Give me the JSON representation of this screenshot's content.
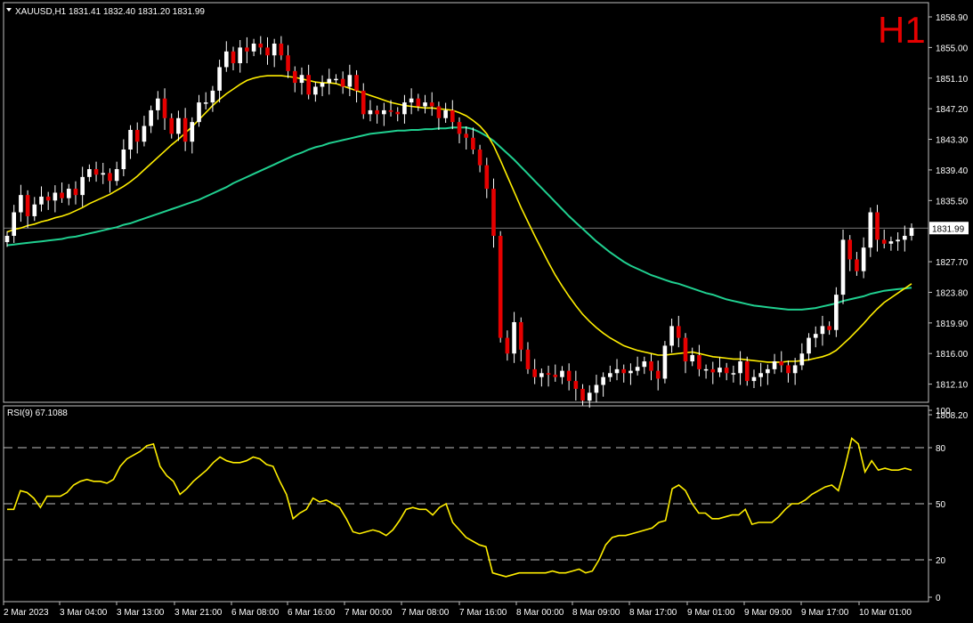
{
  "header": {
    "symbol_line": "XAUUSD,H1  1831.41 1832.40 1831.20 1831.99",
    "timeframe_badge": "H1",
    "rsi_label": "RSI(9) 67.1088"
  },
  "colors": {
    "background": "#000000",
    "bull_candle": "#ffffff",
    "bear_candle": "#e60000",
    "wick": "#ffffff",
    "ma_fast": "#ffee00",
    "ma_slow": "#20d090",
    "rsi_line": "#ffee00",
    "grid_frame": "#c0c0c0",
    "badge": "#e60000"
  },
  "chart_data": [
    {
      "type": "candlestick",
      "title": "XAUUSD,H1",
      "ylim": [
        1808.2,
        1858.9
      ],
      "yticks": [
        1858.9,
        1855.0,
        1851.1,
        1847.2,
        1843.3,
        1839.4,
        1835.5,
        1831.99,
        1827.7,
        1823.8,
        1819.9,
        1816.0,
        1812.1,
        1808.2
      ],
      "ytick_labels": [
        "1858.90",
        "1855.00",
        "1851.10",
        "1847.20",
        "1843.30",
        "1839.40",
        "1835.50",
        "1831.99",
        "1827.70",
        "1823.80",
        "1819.90",
        "1816.00",
        "1812.10",
        "1808.20"
      ],
      "current_price": 1831.99,
      "xtick_labels": [
        "2 Mar 2023",
        "3 Mar 04:00",
        "3 Mar 13:00",
        "3 Mar 21:00",
        "6 Mar 08:00",
        "6 Mar 16:00",
        "7 Mar 00:00",
        "7 Mar 08:00",
        "7 Mar 16:00",
        "8 Mar 00:00",
        "8 Mar 09:00",
        "8 Mar 17:00",
        "9 Mar 01:00",
        "9 Mar 09:00",
        "9 Mar 17:00",
        "10 Mar 01:00"
      ],
      "close": [
        1831.0,
        1834.0,
        1836.2,
        1833.5,
        1835.0,
        1836.0,
        1835.5,
        1836.5,
        1835.8,
        1837.0,
        1836.2,
        1838.5,
        1839.5,
        1838.8,
        1839.0,
        1838.0,
        1839.5,
        1842.0,
        1844.5,
        1843.0,
        1845.0,
        1847.0,
        1848.5,
        1846.0,
        1844.0,
        1846.0,
        1843.0,
        1845.5,
        1848.0,
        1848.0,
        1849.5,
        1852.5,
        1854.5,
        1853.0,
        1855.0,
        1854.5,
        1855.5,
        1855.0,
        1854.0,
        1855.5,
        1854.0,
        1852.0,
        1850.5,
        1851.5,
        1849.0,
        1850.0,
        1850.5,
        1851.0,
        1851.0,
        1850.0,
        1851.5,
        1849.5,
        1846.5,
        1847.0,
        1846.5,
        1847.0,
        1846.8,
        1846.5,
        1848.0,
        1848.5,
        1847.5,
        1848.0,
        1847.5,
        1846.0,
        1847.0,
        1845.5,
        1844.0,
        1843.5,
        1842.0,
        1840.0,
        1837.0,
        1831.0,
        1818.0,
        1816.0,
        1820.0,
        1816.5,
        1814.0,
        1813.0,
        1813.5,
        1813.3,
        1813.0,
        1813.8,
        1812.5,
        1811.5,
        1810.0,
        1811.0,
        1812.0,
        1813.0,
        1813.5,
        1814.0,
        1813.5,
        1813.8,
        1814.3,
        1815.0,
        1813.8,
        1812.8,
        1817.0,
        1819.5,
        1818.0,
        1815.0,
        1815.8,
        1814.0,
        1814.0,
        1813.6,
        1814.2,
        1813.5,
        1813.5,
        1815.0,
        1812.5,
        1813.0,
        1813.5,
        1814.0,
        1815.0,
        1814.5,
        1813.5,
        1814.5,
        1816.0,
        1818.0,
        1818.5,
        1819.5,
        1819.0,
        1823.5,
        1830.5,
        1828.0,
        1826.5,
        1829.5,
        1834.0,
        1830.5,
        1830.0,
        1830.3,
        1830.5,
        1831.0,
        1831.99
      ],
      "ma_fast": [
        1831.5,
        1831.8,
        1832.0,
        1832.3,
        1832.5,
        1832.8,
        1833.0,
        1833.3,
        1833.5,
        1833.8,
        1834.2,
        1834.6,
        1835.1,
        1835.5,
        1835.9,
        1836.3,
        1836.8,
        1837.3,
        1837.9,
        1838.6,
        1839.4,
        1840.2,
        1841.0,
        1841.8,
        1842.6,
        1843.3,
        1844.1,
        1844.9,
        1845.8,
        1846.7,
        1847.6,
        1848.4,
        1849.1,
        1849.7,
        1850.3,
        1850.8,
        1851.1,
        1851.3,
        1851.4,
        1851.4,
        1851.4,
        1851.3,
        1851.2,
        1851.0,
        1850.8,
        1850.6,
        1850.5,
        1850.5,
        1850.4,
        1850.1,
        1849.8,
        1849.5,
        1849.2,
        1848.9,
        1848.6,
        1848.3,
        1848.0,
        1847.8,
        1847.6,
        1847.5,
        1847.4,
        1847.3,
        1847.3,
        1847.2,
        1847.1,
        1847.0,
        1846.7,
        1846.3,
        1845.7,
        1845.0,
        1844.0,
        1842.5,
        1840.6,
        1838.6,
        1836.6,
        1834.6,
        1832.8,
        1831.0,
        1829.3,
        1827.6,
        1826.0,
        1824.6,
        1823.3,
        1822.1,
        1821.0,
        1820.1,
        1819.3,
        1818.6,
        1818.0,
        1817.5,
        1817.0,
        1816.7,
        1816.4,
        1816.2,
        1816.0,
        1815.8,
        1815.8,
        1815.9,
        1816.0,
        1816.1,
        1816.2,
        1816.0,
        1815.8,
        1815.6,
        1815.5,
        1815.4,
        1815.3,
        1815.3,
        1815.2,
        1815.1,
        1815.0,
        1814.9,
        1814.9,
        1814.9,
        1815.0,
        1815.0,
        1815.1,
        1815.2,
        1815.4,
        1815.6,
        1815.9,
        1816.4,
        1817.2,
        1818.0,
        1818.9,
        1819.8,
        1820.8,
        1821.7,
        1822.5,
        1823.1,
        1823.7,
        1824.3,
        1824.9
      ],
      "ma_slow": [
        1829.8,
        1829.9,
        1830.0,
        1830.1,
        1830.2,
        1830.3,
        1830.4,
        1830.5,
        1830.6,
        1830.8,
        1830.9,
        1831.1,
        1831.3,
        1831.5,
        1831.7,
        1831.9,
        1832.1,
        1832.4,
        1832.6,
        1832.9,
        1833.2,
        1833.5,
        1833.8,
        1834.1,
        1834.4,
        1834.7,
        1835.0,
        1835.3,
        1835.6,
        1836.0,
        1836.4,
        1836.8,
        1837.2,
        1837.7,
        1838.1,
        1838.5,
        1838.9,
        1839.3,
        1839.7,
        1840.1,
        1840.5,
        1840.9,
        1841.3,
        1841.6,
        1842.0,
        1842.3,
        1842.5,
        1842.8,
        1843.0,
        1843.2,
        1843.4,
        1843.6,
        1843.8,
        1844.0,
        1844.1,
        1844.2,
        1844.3,
        1844.4,
        1844.4,
        1844.5,
        1844.5,
        1844.6,
        1844.6,
        1844.7,
        1844.7,
        1844.8,
        1844.8,
        1844.8,
        1844.6,
        1844.2,
        1843.7,
        1843.1,
        1842.3,
        1841.5,
        1840.7,
        1839.8,
        1838.9,
        1838.0,
        1837.1,
        1836.2,
        1835.3,
        1834.4,
        1833.5,
        1832.7,
        1831.9,
        1831.1,
        1830.3,
        1829.6,
        1828.9,
        1828.3,
        1827.7,
        1827.2,
        1826.8,
        1826.4,
        1826.0,
        1825.7,
        1825.4,
        1825.1,
        1824.9,
        1824.6,
        1824.3,
        1824.0,
        1823.7,
        1823.5,
        1823.2,
        1822.9,
        1822.7,
        1822.5,
        1822.3,
        1822.1,
        1822.0,
        1821.9,
        1821.8,
        1821.7,
        1821.6,
        1821.6,
        1821.6,
        1821.7,
        1821.8,
        1822.0,
        1822.2,
        1822.4,
        1822.7,
        1822.9,
        1823.1,
        1823.3,
        1823.6,
        1823.8,
        1824.0,
        1824.1,
        1824.2,
        1824.3,
        1824.4
      ]
    },
    {
      "type": "line",
      "title": "RSI(9) 67.1088",
      "ylim": [
        0,
        100
      ],
      "yticks": [
        100,
        80,
        50,
        20,
        0
      ],
      "levels": [
        80,
        50,
        20
      ],
      "values": [
        47,
        47,
        57,
        56,
        53,
        48,
        54,
        54,
        54,
        56,
        60,
        62,
        63,
        62,
        62,
        61,
        63,
        70,
        74,
        76,
        78,
        81,
        82,
        70,
        65,
        62,
        55,
        58,
        62,
        65,
        68,
        72,
        75,
        73,
        72,
        72,
        73,
        75,
        74,
        71,
        70,
        62,
        55,
        42,
        45,
        47,
        53,
        51,
        52,
        50,
        48,
        42,
        35,
        34,
        35,
        36,
        35,
        33,
        36,
        41,
        47,
        48,
        47,
        47,
        44,
        48,
        50,
        40,
        36,
        32,
        30,
        28,
        27,
        13,
        12,
        11,
        12,
        13,
        13,
        13,
        13,
        13,
        14,
        13,
        13,
        14,
        15,
        13,
        14,
        20,
        28,
        32,
        33,
        33,
        34,
        35,
        36,
        37,
        40,
        41,
        58,
        60,
        57,
        50,
        45,
        45,
        42,
        42,
        43,
        44,
        44,
        47,
        39,
        40,
        40,
        40,
        43,
        47,
        50,
        50,
        52,
        55,
        57,
        59,
        60,
        57,
        70,
        85,
        82,
        67,
        73,
        68,
        69,
        68,
        68,
        69,
        68
      ]
    }
  ]
}
